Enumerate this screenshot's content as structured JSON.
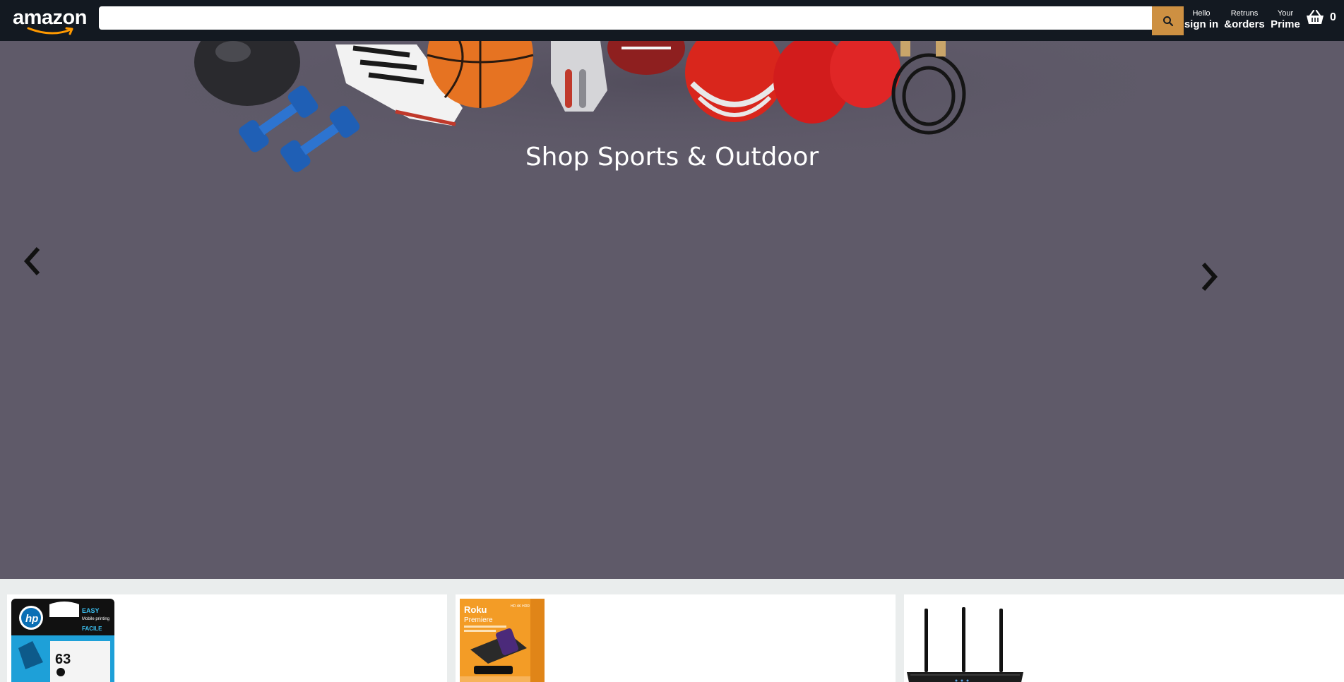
{
  "header": {
    "logo_text": "amazon",
    "search": {
      "placeholder": "",
      "value": ""
    },
    "nav": [
      {
        "line1": "Hello",
        "line2": "sign in"
      },
      {
        "line1": "Retruns",
        "line2": "&orders"
      },
      {
        "line1": "Your",
        "line2": "Prime"
      }
    ],
    "basket_count": "0"
  },
  "hero": {
    "title": "Shop Sports & Outdoor",
    "background_color": "#5f5a69"
  },
  "products": [
    {
      "icon": "hp-63-ink-cartridge",
      "brand": "hp",
      "badge": "EASY",
      "number": "63"
    },
    {
      "icon": "roku-premiere-box",
      "brand": "Roku",
      "subtitle": "Premiere"
    },
    {
      "icon": "wifi-router"
    }
  ],
  "colors": {
    "header_bg": "#131921",
    "search_button": "#cd9042",
    "page_bg": "#eaeded"
  }
}
